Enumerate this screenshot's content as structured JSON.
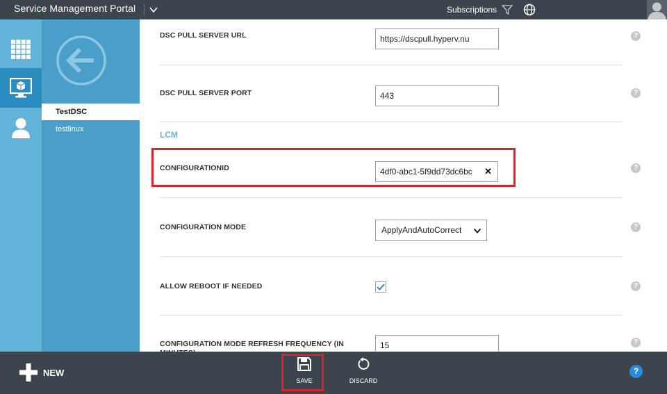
{
  "header": {
    "portal_title": "Service Management Portal",
    "subscriptions_label": "Subscriptions"
  },
  "sidebar": {
    "rail_icons": [
      "grid-icon",
      "vm-icon",
      "user-icon"
    ],
    "items": [
      {
        "label": "TestDSC",
        "selected": true
      },
      {
        "label": "testlinux",
        "selected": false
      }
    ]
  },
  "form": {
    "dsc_pull_server_url": {
      "label": "DSC PULL SERVER URL",
      "value": "https://dscpull.hyperv.nu"
    },
    "dsc_pull_server_port": {
      "label": "DSC PULL SERVER PORT",
      "value": "443"
    },
    "section_lcm": "LCM",
    "configuration_id": {
      "label": "CONFIGURATIONID",
      "value": "4df0-abc1-5f9dd73dc6bc",
      "clear": "✕"
    },
    "configuration_mode": {
      "label": "CONFIGURATION MODE",
      "value": "ApplyAndAutoCorrect"
    },
    "allow_reboot": {
      "label": "ALLOW REBOOT IF NEEDED",
      "checked": true
    },
    "refresh_frequency": {
      "label": "CONFIGURATION MODE REFRESH FREQUENCY (IN MINUTES)",
      "value": "15"
    },
    "help_glyph": "?"
  },
  "toolbar": {
    "new_label": "NEW",
    "save_label": "SAVE",
    "discard_label": "DISCARD",
    "help_glyph": "?"
  },
  "colors": {
    "header_bg": "#3c444e",
    "rail_bg": "#63b3d8",
    "rail_active": "#2a8cbf",
    "panel_bg": "#4a9fc9",
    "highlight_red": "#d9232a",
    "section_color": "#6ab5d8"
  }
}
